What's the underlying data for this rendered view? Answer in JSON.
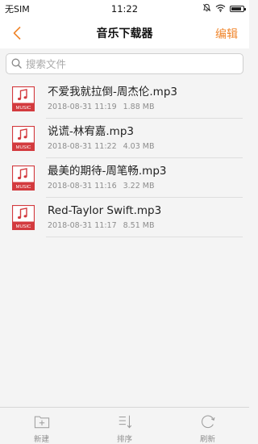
{
  "status_bar": {
    "carrier": "无SIM",
    "time": "11:22",
    "battery_level": 0.85
  },
  "nav": {
    "title": "音乐下载器",
    "edit_label": "编辑"
  },
  "search": {
    "placeholder": "搜索文件",
    "value": ""
  },
  "files": [
    {
      "name": "不爱我就拉倒-周杰伦.mp3",
      "date": "2018-08-31 11:19",
      "size": "1.88 MB",
      "icon_label": "MUSIC"
    },
    {
      "name": "说谎-林宥嘉.mp3",
      "date": "2018-08-31 11:22",
      "size": "4.03 MB",
      "icon_label": "MUSIC"
    },
    {
      "name": "最美的期待-周笔畅.mp3",
      "date": "2018-08-31 11:16",
      "size": "3.22 MB",
      "icon_label": "MUSIC"
    },
    {
      "name": "Red-Taylor Swift.mp3",
      "date": "2018-08-31 11:17",
      "size": "8.51 MB",
      "icon_label": "MUSIC"
    }
  ],
  "toolbar": {
    "new_label": "新建",
    "sort_label": "排序",
    "refresh_label": "刷新"
  },
  "colors": {
    "accent": "#f0862c",
    "music_icon": "#d33a3e"
  }
}
